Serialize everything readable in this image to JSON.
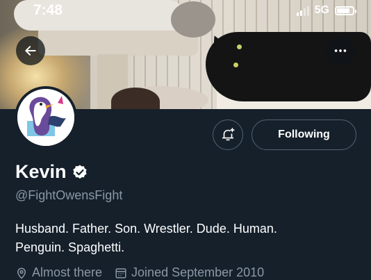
{
  "status_bar": {
    "time": "7:48",
    "network": "5G",
    "signal_bars_active": 2,
    "battery_level": 0.85
  },
  "header": {
    "back_icon": "arrow-left-icon",
    "more_icon": "more-horizontal-icon"
  },
  "profile": {
    "display_name": "Kevin",
    "verified_icon": "verified-badge-icon",
    "handle": "@FightOwensFight",
    "bio": "Husband. Father. Son. Wrestler. Dude. Human.\nPenguin. Spaghetti.",
    "location": "Almost there",
    "joined": "Joined September 2010"
  },
  "actions": {
    "notify_icon": "bell-plus-icon",
    "following_label": "Following"
  },
  "colors": {
    "background": "#15202b",
    "secondary_text": "#8b98a5",
    "button_border": "#536471"
  }
}
